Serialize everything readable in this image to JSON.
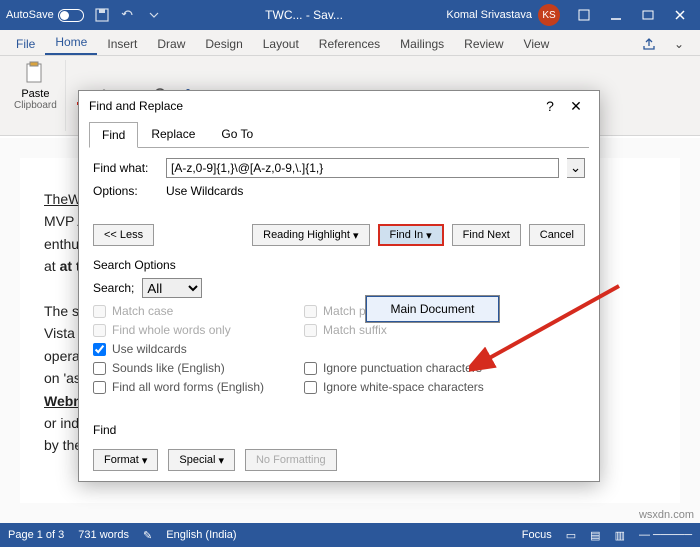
{
  "titlebar": {
    "autosave": "AutoSave",
    "doc_title": "TWC... - Sav...",
    "user_name": "Komal Srivastava",
    "user_initials": "KS"
  },
  "ribbon": {
    "tabs": [
      "File",
      "Home",
      "Insert",
      "Draw",
      "Design",
      "Layout",
      "References",
      "Mailings",
      "Review",
      "View"
    ],
    "active": 1,
    "groups": {
      "clipboard": "Clipboard",
      "paste": "Paste"
    }
  },
  "document": {
    "lines": [
      "TheWi",
      "MVP A",
      "enthus",
      "at thew",
      "",
      "The sit",
      "Vista u",
      "operat",
      "on 'as-",
      "Webm",
      "or indi",
      "by the"
    ]
  },
  "dialog": {
    "title": "Find and Replace",
    "tabs": [
      "Find",
      "Replace",
      "Go To"
    ],
    "active_tab": 0,
    "find_label": "Find what:",
    "find_value": "[A-z,0-9]{1,}\\@[A-z,0-9,\\.]{1,}",
    "options_label": "Options:",
    "options_value": "Use Wildcards",
    "btn_less": "<< Less",
    "btn_reading": "Reading Highlight",
    "btn_findin": "Find In",
    "btn_findnext": "Find Next",
    "btn_cancel": "Cancel",
    "menu_main": "Main Document",
    "search_options": "Search Options",
    "search_label": "Search;",
    "search_dir": "All",
    "chk_matchcase": "Match case",
    "chk_wholewords": "Find whole words only",
    "chk_wildcards": "Use wildcards",
    "chk_sounds": "Sounds like (English)",
    "chk_wordforms": "Find all word forms (English)",
    "chk_prefix": "Match prefix",
    "chk_suffix": "Match suffix",
    "chk_punct": "Ignore punctuation characters",
    "chk_white": "Ignore white-space characters",
    "find_section": "Find",
    "btn_format": "Format",
    "btn_special": "Special",
    "btn_noformat": "No Formatting"
  },
  "status": {
    "page": "Page 1 of 3",
    "words": "731 words",
    "lang": "English (India)",
    "focus": "Focus"
  },
  "watermark": "wsxdn.com"
}
